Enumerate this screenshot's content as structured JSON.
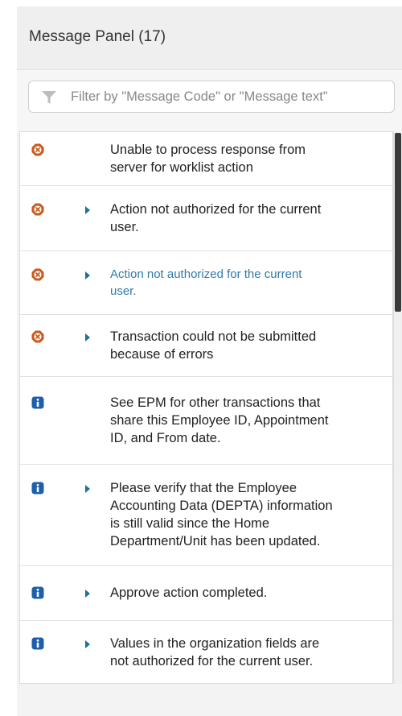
{
  "panel": {
    "title": "Message Panel (17)"
  },
  "filter": {
    "placeholder": "Filter by \"Message Code\" or \"Message text\"",
    "value": ""
  },
  "colors": {
    "error": "#c75b1d",
    "info": "#1f5faa",
    "toggle": "#1f6fa0",
    "link": "#2f7aa8"
  },
  "messages": [
    {
      "type": "error",
      "icon": "error-icon",
      "expandable": false,
      "link": false,
      "lines": [
        "Unable to process response from",
        "server for worklist action"
      ]
    },
    {
      "type": "error",
      "icon": "error-icon",
      "expandable": true,
      "link": false,
      "lines": [
        "Action not authorized for the current",
        "user."
      ]
    },
    {
      "type": "error",
      "icon": "error-icon",
      "expandable": true,
      "link": true,
      "lines": [
        "Action not authorized for the current",
        "user."
      ]
    },
    {
      "type": "error",
      "icon": "error-icon",
      "expandable": true,
      "link": false,
      "lines": [
        "Transaction could not be submitted",
        "because of errors"
      ]
    },
    {
      "type": "info",
      "icon": "info-icon",
      "expandable": false,
      "link": false,
      "lines": [
        "See EPM for other transactions that",
        "share this Employee ID, Appointment",
        "ID, and From date."
      ]
    },
    {
      "type": "info",
      "icon": "info-icon",
      "expandable": true,
      "link": false,
      "lines": [
        "Please verify that the Employee",
        "Accounting Data (DEPTA) information",
        "is still valid since the Home",
        "Department/Unit has been updated."
      ]
    },
    {
      "type": "info",
      "icon": "info-icon",
      "expandable": true,
      "link": false,
      "lines": [
        "Approve action completed."
      ]
    },
    {
      "type": "info",
      "icon": "info-icon",
      "expandable": true,
      "link": false,
      "lines": [
        "Values in the organization fields are",
        "not authorized for the current user."
      ]
    }
  ]
}
